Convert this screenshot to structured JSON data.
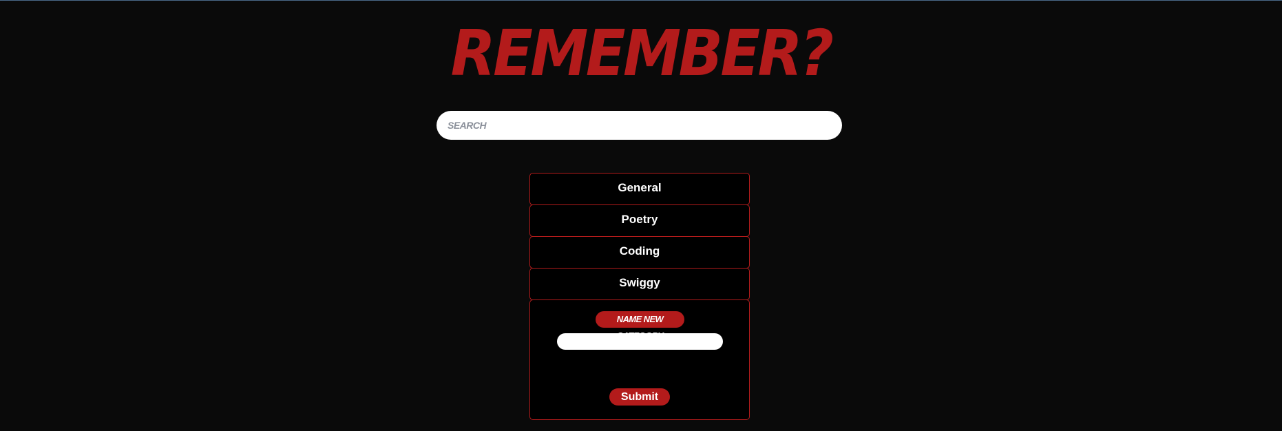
{
  "header": {
    "title": "REMEMBER?"
  },
  "search": {
    "placeholder": "SEARCH",
    "value": ""
  },
  "categories": [
    {
      "label": "General"
    },
    {
      "label": "Poetry"
    },
    {
      "label": "Coding"
    },
    {
      "label": "Swiggy"
    }
  ],
  "new_category": {
    "label": "NAME NEW CATEGORY",
    "input_value": "",
    "submit_label": "Submit"
  },
  "colors": {
    "background": "#0a0a0a",
    "accent": "#b31b1b",
    "text": "#ffffff"
  }
}
